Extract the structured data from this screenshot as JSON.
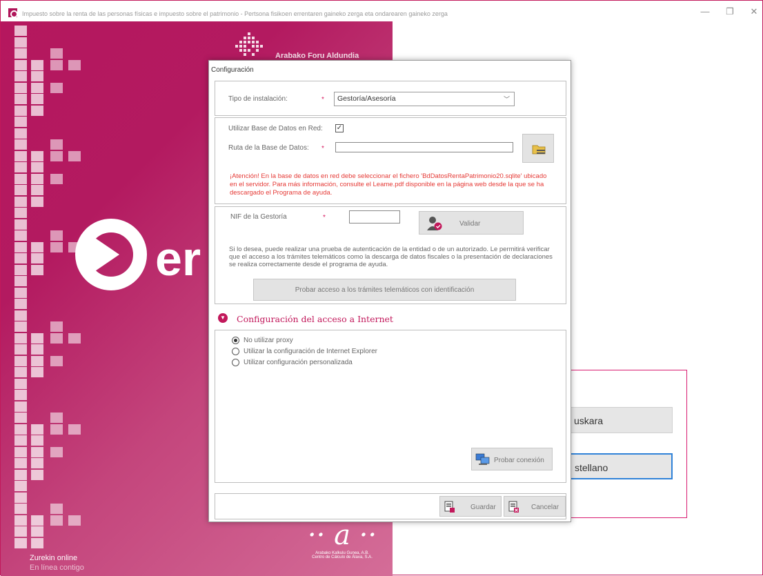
{
  "window": {
    "title": "Impuesto sobre la renta de las personas físicas e impuesto sobre el patrimonio - Pertsona fisikoen errentaren gaineko zerga eta ondarearen gaineko zerga",
    "minimize": "—",
    "maximize": "❐",
    "close": "✕"
  },
  "splash": {
    "org_name": "Arabako Foru Aldundia",
    "brand": "er",
    "footer_line1": "Zurekin online",
    "footer_line2": "En línea contigo",
    "partner_letter": "·· a ··",
    "partner_line1": "Arabako Kalkulu Gunea, A.B.",
    "partner_line2": "Centro de Cálculo de Álava, S.A."
  },
  "language": {
    "euskara": "uskara",
    "castellano": "stellano"
  },
  "dialog": {
    "title": "Configuración",
    "install_type_label": "Tipo de instalación:",
    "install_type_value": "Gestoría/Asesoría",
    "required_mark": "*",
    "use_network_db_label": "Utilizar Base de Datos en Red:",
    "use_network_db_checked": "✓",
    "db_path_label": "Ruta de la Base de Datos:",
    "db_path_value": "",
    "warning_text": "¡Atención! En la base de datos en red debe seleccionar el fichero 'BdDatosRentaPatrimonio20.sqlite' ubicado en el servidor. Para más información, consulte el Leame.pdf disponible en la página web desde la que se ha descargado el Programa de ayuda.",
    "nif_label": "NIF de la Gestoría",
    "nif_value": "",
    "validate_button": "Validar",
    "info_text": "Si lo desea, puede realizar una prueba de autenticación de la entidad o de un autorizado. Le permitirá verificar que el acceso a los trámites telemáticos como la descarga de datos fiscales o la presentación de declaraciones se realiza correctamente desde el programa de ayuda.",
    "test_access_button": "Probar acceso a los trámites telemáticos con identificación",
    "internet_section_title": "Configuración del acceso a Internet",
    "proxy_options": [
      "No utilizar proxy",
      "Utilizar la configuración de Internet Explorer",
      "Utilizar configuración personalizada"
    ],
    "selected_proxy_index": 0,
    "test_connection_button": "Probar conexión",
    "save_button": "Guardar",
    "cancel_button": "Cancelar"
  },
  "colors": {
    "brand": "#b5175e",
    "warning": "#e53935",
    "accent_border": "#d81b70",
    "selected_border": "#2f82d8"
  }
}
